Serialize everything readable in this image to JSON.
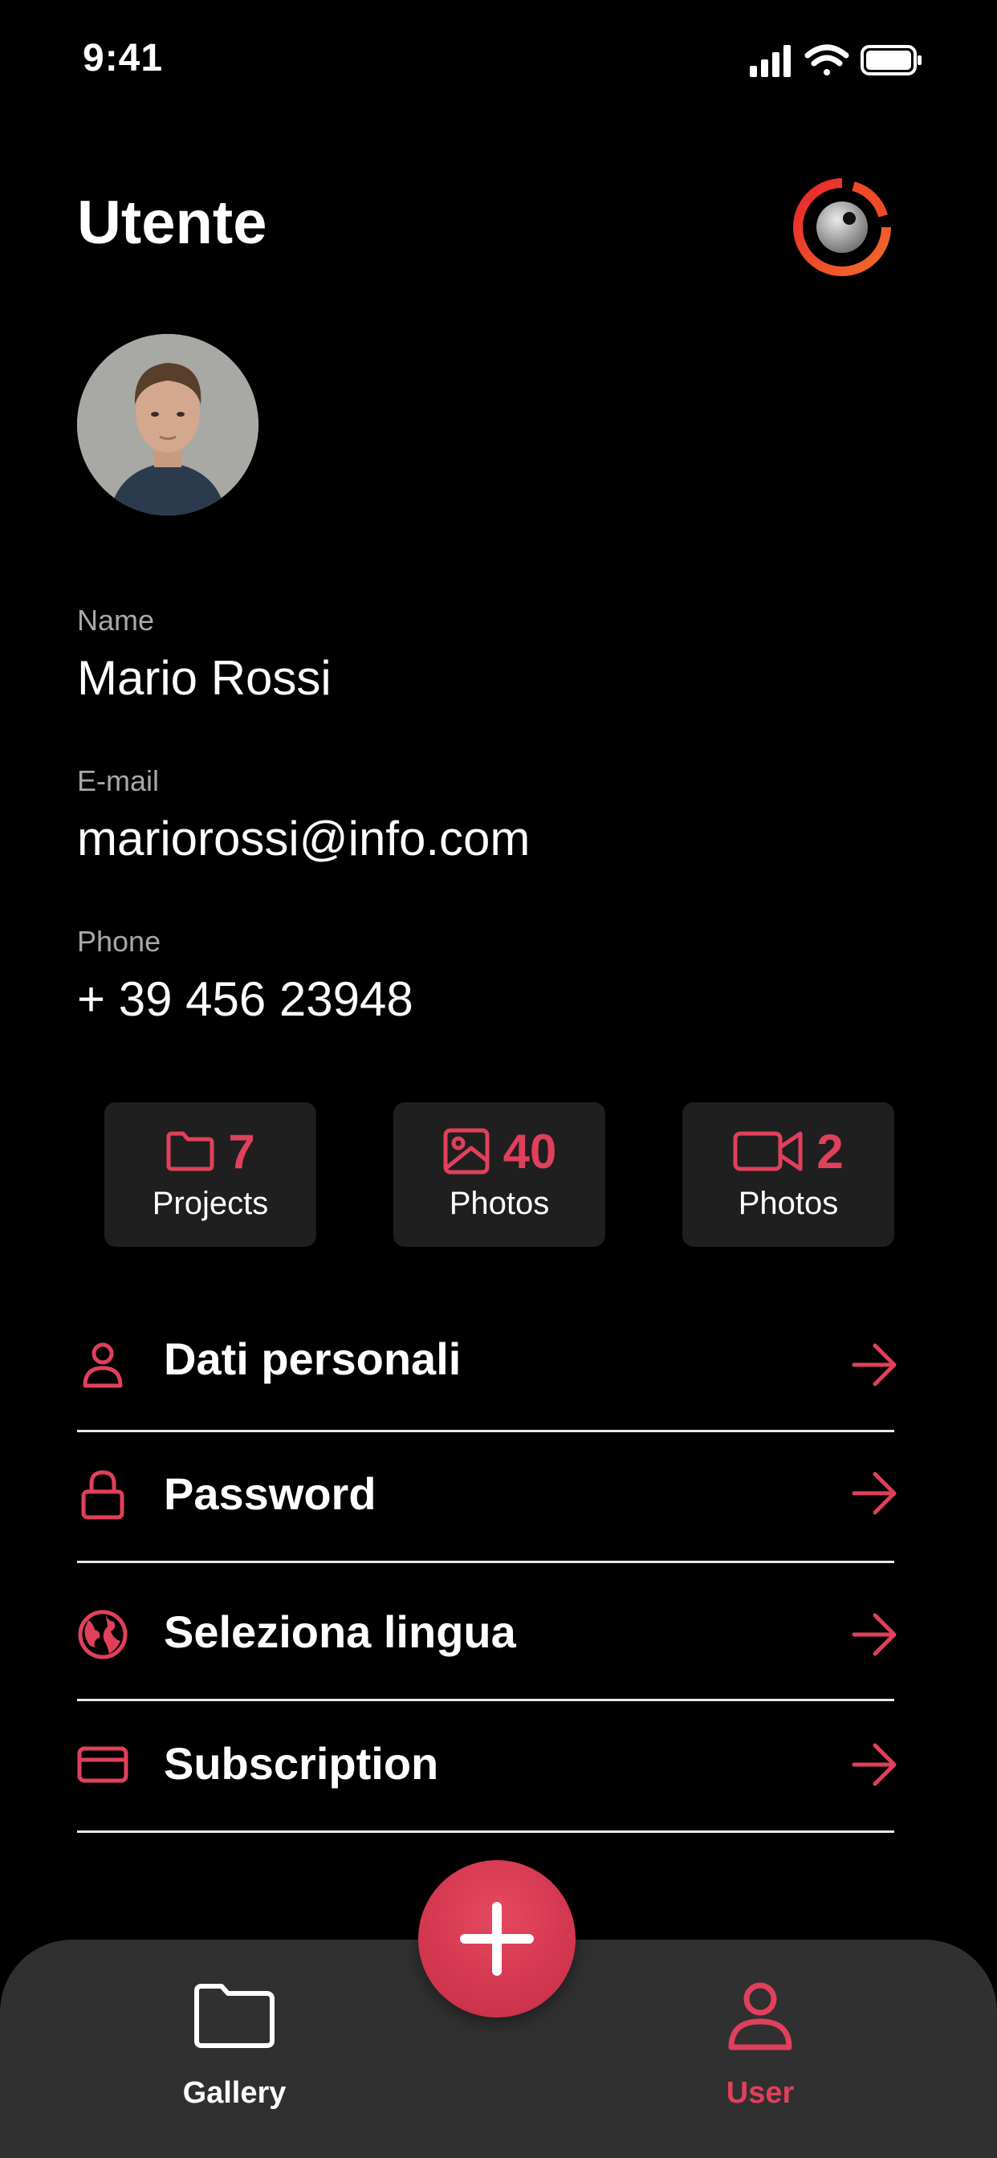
{
  "status_bar": {
    "time": "9:41"
  },
  "header": {
    "title": "Utente",
    "logo_icon": "camera-lens-logo"
  },
  "profile": {
    "avatar_icon": "user-photo",
    "name_label": "Name",
    "name_value": "Mario Rossi",
    "email_label": "E-mail",
    "email_value": "mariorossi@info.com",
    "phone_label": "Phone",
    "phone_value": "+ 39 456 23948"
  },
  "stats": [
    {
      "icon": "folder-icon",
      "count": "7",
      "label": "Projects"
    },
    {
      "icon": "image-icon",
      "count": "40",
      "label": "Photos"
    },
    {
      "icon": "video-icon",
      "count": "2",
      "label": "Photos"
    }
  ],
  "menu": [
    {
      "icon": "user-icon",
      "label": "Dati personali"
    },
    {
      "icon": "lock-icon",
      "label": "Password"
    },
    {
      "icon": "globe-icon",
      "label": "Seleziona lingua"
    },
    {
      "icon": "credit-card-icon",
      "label": "Subscription"
    }
  ],
  "bottom_nav": {
    "fab_icon": "plus-icon",
    "items": [
      {
        "icon": "folder-icon",
        "label": "Gallery",
        "active": false
      },
      {
        "icon": "user-icon",
        "label": "User",
        "active": true
      }
    ]
  },
  "colors": {
    "accent": "#e0405c",
    "background": "#000000",
    "card": "#1f1f1f",
    "nav": "#303030"
  }
}
